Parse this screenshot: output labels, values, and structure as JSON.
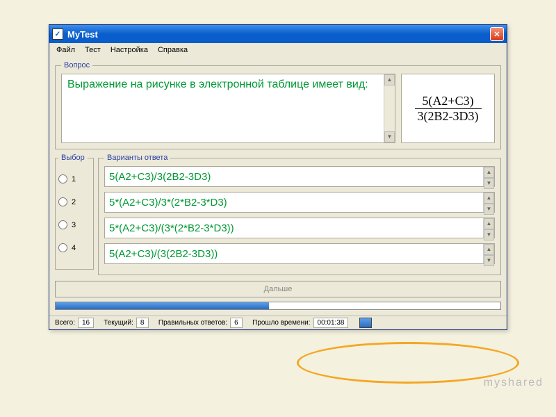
{
  "window": {
    "title": "MyTest",
    "icon_glyph": "✓"
  },
  "menu": {
    "file": "Файл",
    "test": "Тест",
    "settings": "Настройка",
    "help": "Справка"
  },
  "question": {
    "legend": "Вопрос",
    "text": "Выражение на рисунке в электронной таблице имеет вид:",
    "formula_num": "5(A2+C3)",
    "formula_den": "3(2B2-3D3)"
  },
  "choice": {
    "legend": "Выбор",
    "options": [
      "1",
      "2",
      "3",
      "4"
    ]
  },
  "answers": {
    "legend": "Варианты ответа",
    "items": [
      "5(A2+C3)/3(2B2-3D3)",
      "5*(A2+C3)/3*(2*B2-3*D3)",
      "5*(A2+C3)/(3*(2*B2-3*D3))",
      "5(A2+C3)/(3(2B2-3D3))"
    ]
  },
  "next_button": "Дальше",
  "status": {
    "total_label": "Всего:",
    "total_value": "16",
    "current_label": "Текущий:",
    "current_value": "8",
    "correct_label": "Правильных ответов:",
    "correct_value": "6",
    "time_label": "Прошло времени:",
    "time_value": "00:01:38"
  },
  "progress_percent": 48,
  "watermark": "myshared"
}
